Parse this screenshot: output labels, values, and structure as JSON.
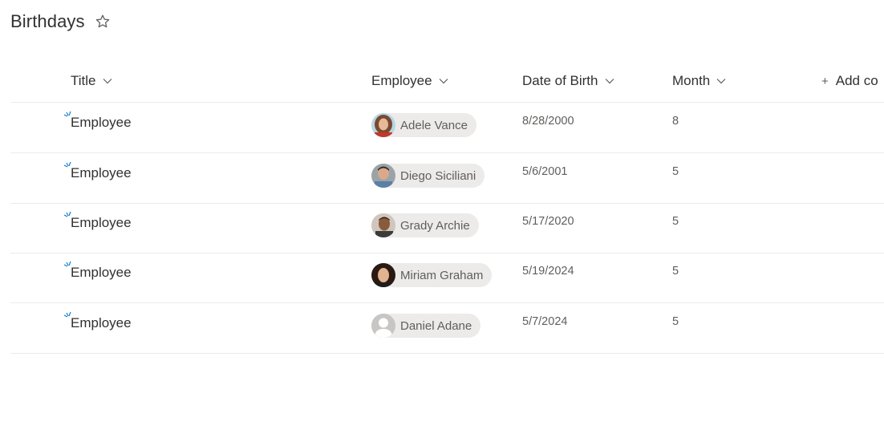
{
  "list": {
    "title": "Birthdays",
    "favorite_icon": "star-outline-icon"
  },
  "columns": [
    {
      "label": "Title",
      "icon": "chevron-down-icon"
    },
    {
      "label": "Employee",
      "icon": "chevron-down-icon"
    },
    {
      "label": "Date of Birth",
      "icon": "chevron-down-icon"
    },
    {
      "label": "Month",
      "icon": "chevron-down-icon"
    }
  ],
  "add_column": {
    "label": "Add co",
    "icon": "plus-icon"
  },
  "rows": [
    {
      "title": "Employee",
      "employee": "Adele Vance",
      "date_of_birth": "8/28/2000",
      "month": "8"
    },
    {
      "title": "Employee",
      "employee": "Diego Siciliani",
      "date_of_birth": "5/6/2001",
      "month": "5"
    },
    {
      "title": "Employee",
      "employee": "Grady Archie",
      "date_of_birth": "5/17/2020",
      "month": "5"
    },
    {
      "title": "Employee",
      "employee": "Miriam Graham",
      "date_of_birth": "5/19/2024",
      "month": "5"
    },
    {
      "title": "Employee",
      "employee": "Daniel Adane",
      "date_of_birth": "5/7/2024",
      "month": "5"
    }
  ],
  "colors": {
    "accent": "#0078d4",
    "divider": "#edebe9",
    "persona_bg": "#edebe9"
  }
}
